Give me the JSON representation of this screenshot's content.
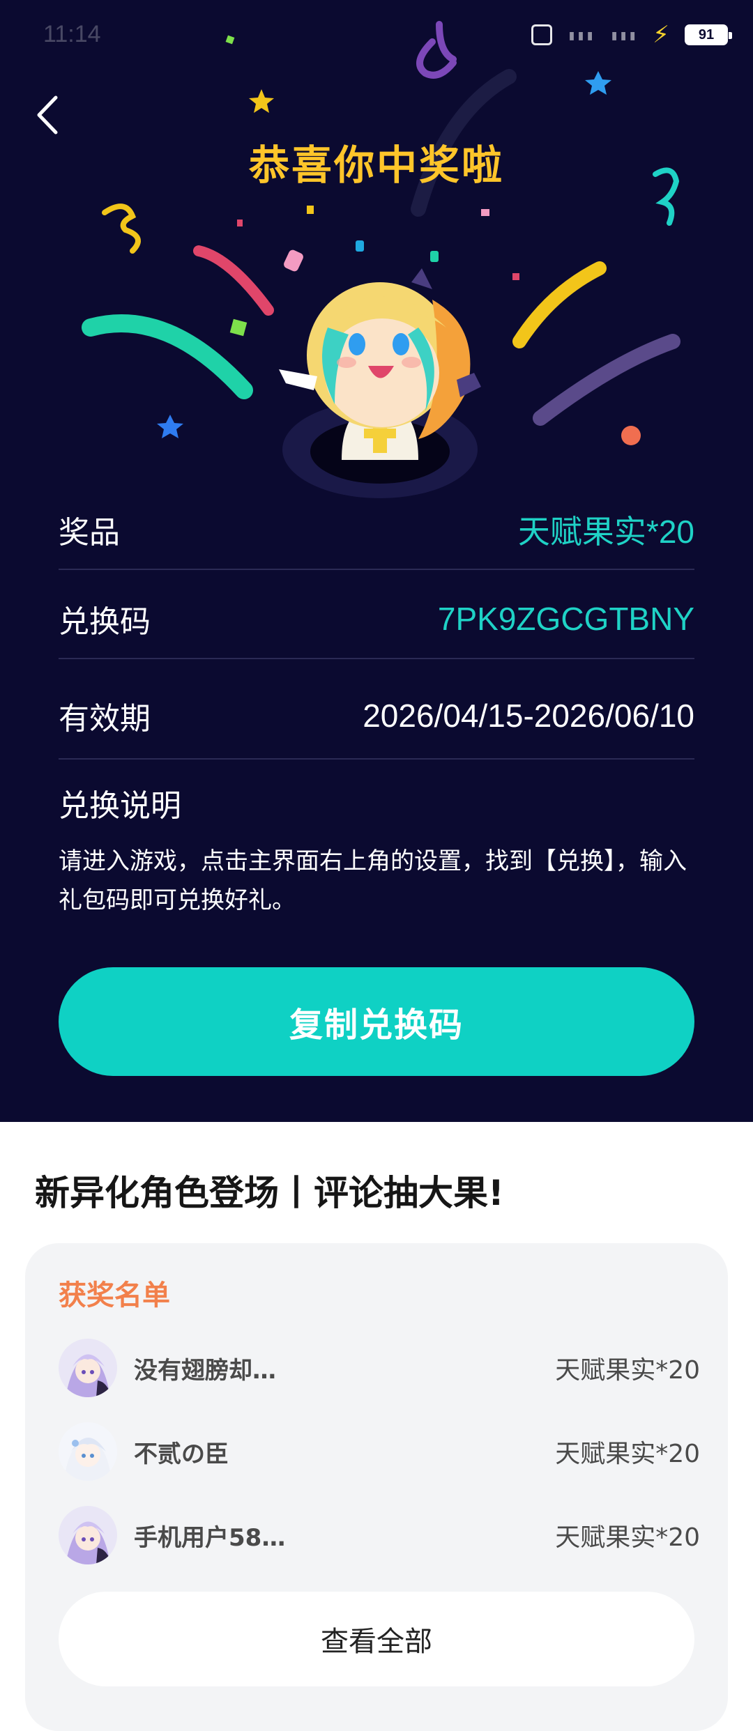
{
  "status_bar": {
    "time": "11:14",
    "battery": "91"
  },
  "header": {
    "title": "恭喜你中奖啦"
  },
  "details": {
    "prize_label": "奖品",
    "prize_value": "天赋果实*20",
    "code_label": "兑换码",
    "code_value": "7PK9ZGCGTBNY",
    "validity_label": "有效期",
    "validity_value": "2026/04/15-2026/06/10",
    "instructions_title": "兑换说明",
    "instructions_text": "请进入游戏，点击主界面右上角的设置，找到【兑换】，输入礼包码即可兑换好礼。"
  },
  "copy_button": {
    "label": "复制兑换码"
  },
  "event": {
    "title": "新异化角色登场丨评论抽大果!"
  },
  "winners": {
    "title": "获奖名单",
    "items": [
      {
        "name": "没有翅膀却…",
        "prize": "天赋果实*20"
      },
      {
        "name": "不贰の臣",
        "prize": "天赋果实*20"
      },
      {
        "name": "手机用户58…",
        "prize": "天赋果实*20"
      }
    ],
    "view_all_label": "查看全部"
  },
  "colors": {
    "background": "#0b0a30",
    "accent_teal": "#0fd1c4",
    "title_gold": "#ffc52a",
    "list_title_orange": "#f2804b"
  }
}
